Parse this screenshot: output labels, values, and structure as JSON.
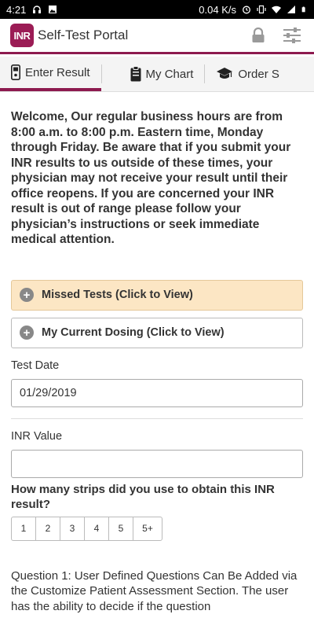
{
  "status_bar": {
    "time": "4:21",
    "speed": "0.04 K/s",
    "battery": ""
  },
  "app_bar": {
    "logo_text": "INR",
    "title": "Self-Test Portal",
    "accent_color": "#8d1a4f",
    "actions": [
      {
        "icon": "lock-icon"
      },
      {
        "icon": "sliders-icon"
      }
    ]
  },
  "tabs": [
    {
      "label": "Enter Result",
      "icon": "meter-icon",
      "active": true
    },
    {
      "label": "My Chart",
      "icon": "clipboard-icon",
      "active": false
    },
    {
      "label": "Order S",
      "icon": "graduation-cap-icon",
      "active": false
    }
  ],
  "main": {
    "welcome": "Welcome, Our regular business hours are from 8:00 a.m. to 8:00 p.m. Eastern time, Monday through Friday. Be aware that if you submit your INR results to us outside of these times, your physician may not receive your result until their office reopens. If you are concerned your INR result is out of range please follow your physician’s instructions or seek immediate medical attention.",
    "accordion": [
      {
        "label": "Missed Tests (Click to View)",
        "highlight": true
      },
      {
        "label": "My Current Dosing (Click to View)",
        "highlight": false
      }
    ],
    "test_date": {
      "label": "Test Date",
      "value": "01/29/2019"
    },
    "inr_value": {
      "label": "INR Value",
      "value": ""
    },
    "strips": {
      "question": "How many strips did you use to obtain this INR result?",
      "options": [
        "1",
        "2",
        "3",
        "4",
        "5",
        "5+"
      ]
    },
    "question1": "Question 1: User Defined Questions Can Be Added via the Customize Patient Assessment Section. The user has the ability to decide if the question"
  }
}
